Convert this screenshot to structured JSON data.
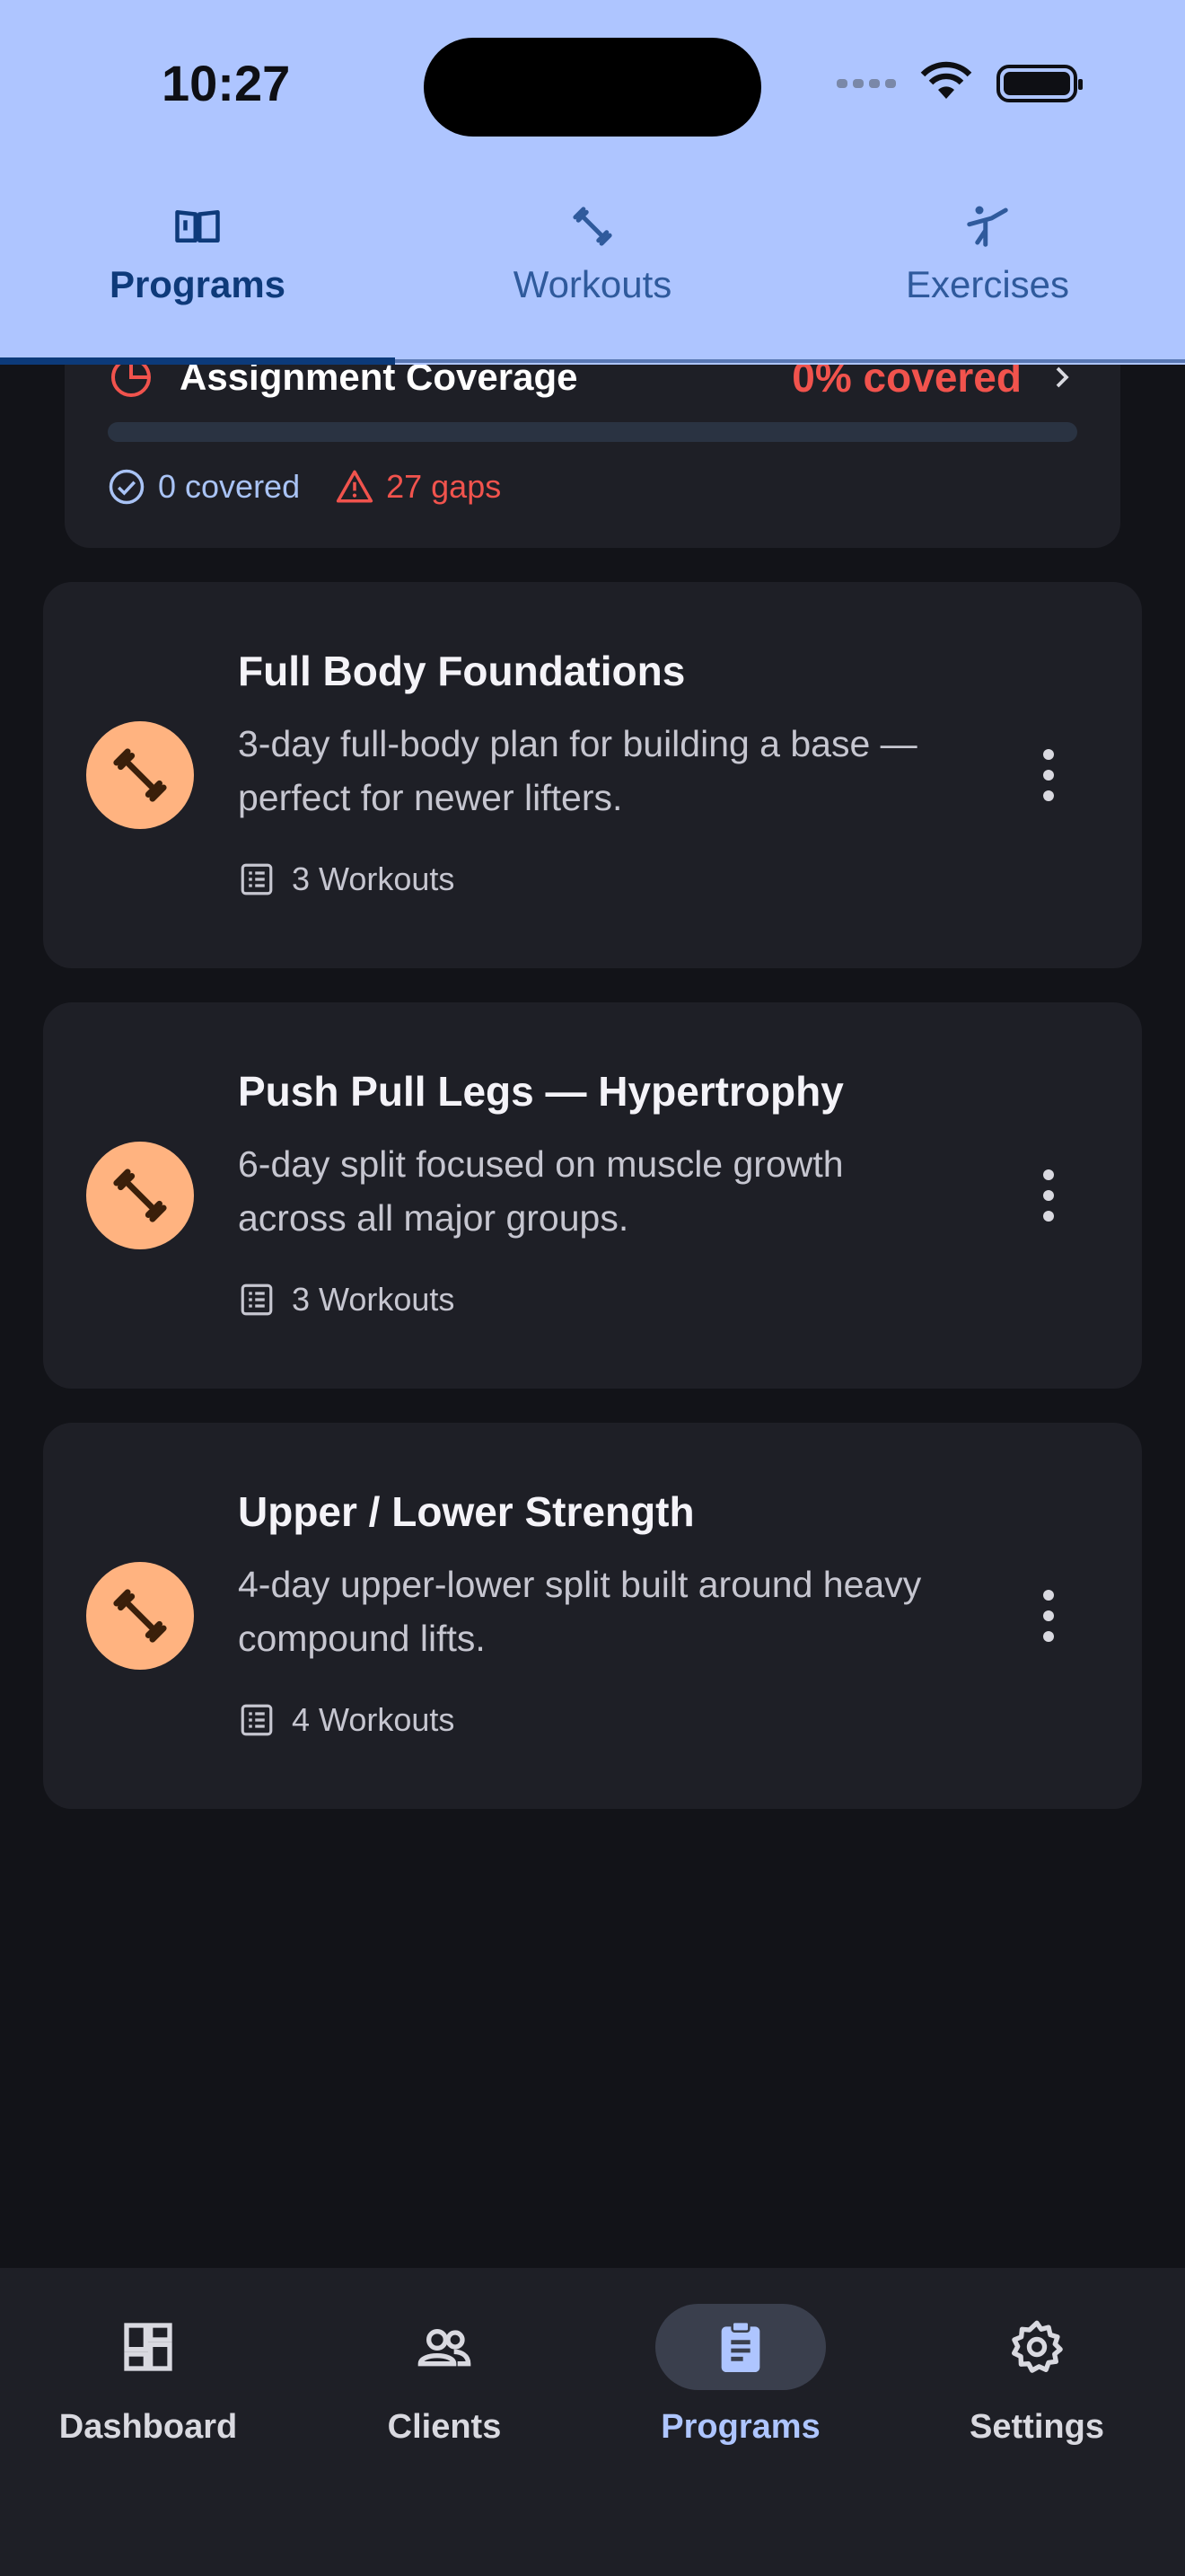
{
  "status_bar": {
    "time": "10:27"
  },
  "top_tabs": [
    {
      "label": "Programs",
      "icon": "book-open-icon",
      "active": true
    },
    {
      "label": "Workouts",
      "icon": "dumbbell-icon",
      "active": false
    },
    {
      "label": "Exercises",
      "icon": "martial-arts-icon",
      "active": false
    }
  ],
  "coverage": {
    "title": "Assignment Coverage",
    "percent_label": "0% covered",
    "progress": 0,
    "covered_label": "0 covered",
    "gaps_label": "27 gaps",
    "colors": {
      "alert": "#f1534d",
      "covered": "#a9c3f5"
    }
  },
  "programs": [
    {
      "title": "Full Body Foundations",
      "description": "3-day full-body plan for building a base — perfect for newer lifters.",
      "workouts_label": "3 Workouts"
    },
    {
      "title": "Push Pull Legs — Hypertrophy",
      "description": "6-day split focused on muscle growth across all major groups.",
      "workouts_label": "3 Workouts"
    },
    {
      "title": "Upper / Lower Strength",
      "description": "4-day upper-lower split built around heavy compound lifts.",
      "workouts_label": "4 Workouts"
    }
  ],
  "bottom_nav": [
    {
      "label": "Dashboard",
      "icon": "dashboard-icon",
      "active": false
    },
    {
      "label": "Clients",
      "icon": "clients-icon",
      "active": false
    },
    {
      "label": "Programs",
      "icon": "clipboard-icon",
      "active": true
    },
    {
      "label": "Settings",
      "icon": "gear-icon",
      "active": false
    }
  ],
  "theme": {
    "header_bg": "#aec5ff",
    "avatar_bg": "#ffb380",
    "card_bg": "#1e1f26"
  }
}
